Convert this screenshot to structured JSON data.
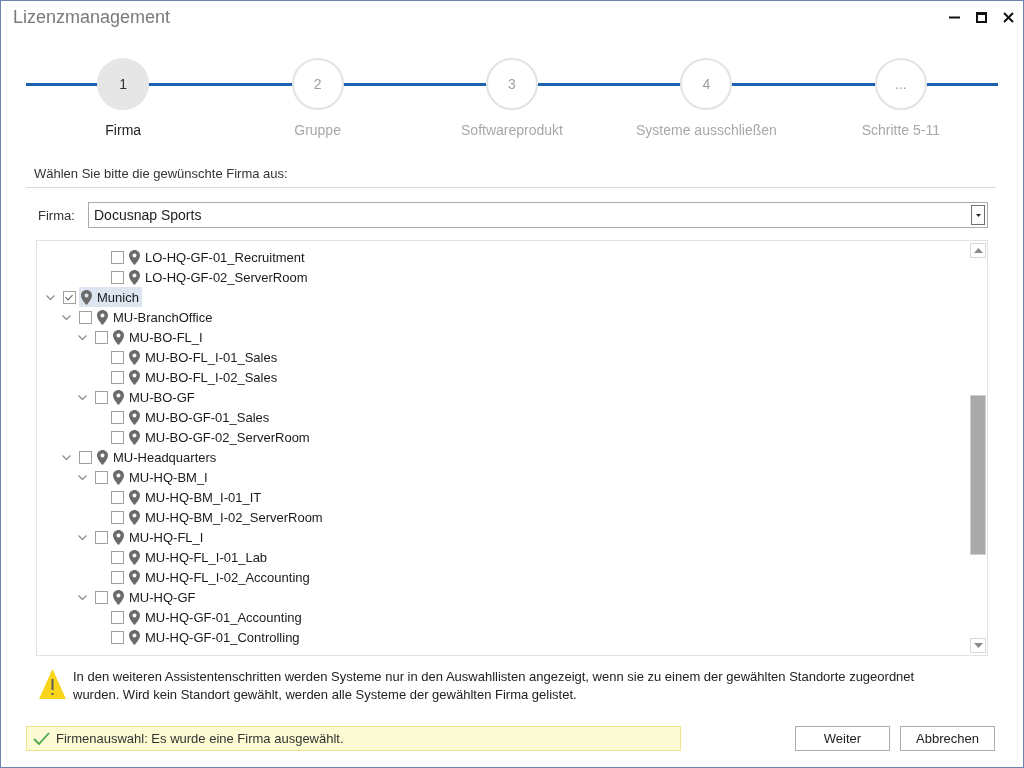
{
  "window": {
    "title": "Lizenzmanagement"
  },
  "steps": [
    {
      "number": "1",
      "label": "Firma",
      "selected": true
    },
    {
      "number": "2",
      "label": "Gruppe",
      "selected": false
    },
    {
      "number": "3",
      "label": "Softwareprodukt",
      "selected": false
    },
    {
      "number": "4",
      "label": "Systeme ausschließen",
      "selected": false
    },
    {
      "number": "...",
      "label": "Schritte 5-11",
      "selected": false
    }
  ],
  "instruction": "Wählen Sie bitte die gewünschte Firma aus:",
  "company": {
    "label": "Firma:",
    "value": "Docusnap Sports"
  },
  "tree": {
    "items": [
      {
        "children": [
          {
            "children": [
              {
                "children": [
                  {
                    "label": "LO-HQ-GF-01_Recruitment",
                    "checked": false,
                    "selected": false
                  },
                  {
                    "label": "LO-HQ-GF-02_ServerRoom",
                    "checked": false,
                    "selected": false
                  }
                ]
              }
            ]
          }
        ]
      },
      {
        "label": "Munich",
        "checked": true,
        "selected": true,
        "expanded": true,
        "children": [
          {
            "label": "MU-BranchOffice",
            "checked": false,
            "selected": false,
            "expanded": true,
            "children": [
              {
                "label": "MU-BO-FL_I",
                "checked": false,
                "selected": false,
                "expanded": true,
                "children": [
                  {
                    "label": "MU-BO-FL_I-01_Sales",
                    "checked": false,
                    "selected": false
                  },
                  {
                    "label": "MU-BO-FL_I-02_Sales",
                    "checked": false,
                    "selected": false
                  }
                ]
              },
              {
                "label": "MU-BO-GF",
                "checked": false,
                "selected": false,
                "expanded": true,
                "children": [
                  {
                    "label": "MU-BO-GF-01_Sales",
                    "checked": false,
                    "selected": false
                  },
                  {
                    "label": "MU-BO-GF-02_ServerRoom",
                    "checked": false,
                    "selected": false
                  }
                ]
              }
            ]
          },
          {
            "label": "MU-Headquarters",
            "checked": false,
            "selected": false,
            "expanded": true,
            "children": [
              {
                "label": "MU-HQ-BM_I",
                "checked": false,
                "selected": false,
                "expanded": true,
                "children": [
                  {
                    "label": "MU-HQ-BM_I-01_IT",
                    "checked": false,
                    "selected": false
                  },
                  {
                    "label": "MU-HQ-BM_I-02_ServerRoom",
                    "checked": false,
                    "selected": false
                  }
                ]
              },
              {
                "label": "MU-HQ-FL_I",
                "checked": false,
                "selected": false,
                "expanded": true,
                "children": [
                  {
                    "label": "MU-HQ-FL_I-01_Lab",
                    "checked": false,
                    "selected": false
                  },
                  {
                    "label": "MU-HQ-FL_I-02_Accounting",
                    "checked": false,
                    "selected": false
                  }
                ]
              },
              {
                "label": "MU-HQ-GF",
                "checked": false,
                "selected": false,
                "expanded": true,
                "children": [
                  {
                    "label": "MU-HQ-GF-01_Accounting",
                    "checked": false,
                    "selected": false
                  },
                  {
                    "label": "MU-HQ-GF-01_Controlling",
                    "checked": false,
                    "selected": false
                  }
                ]
              }
            ]
          }
        ]
      }
    ]
  },
  "warning": "In den weiteren Assistentenschritten werden Systeme nur in den Auswahllisten angezeigt, wenn sie zu einem der gewählten Standorte zugeordnet wurden. Wird kein Standort gewählt, werden alle Systeme der gewählten Firma gelistet.",
  "status": {
    "text": "Firmenauswahl: Es wurde eine Firma ausgewählt."
  },
  "buttons": [
    {
      "label": "Weiter"
    },
    {
      "label": "Abbrechen"
    }
  ]
}
